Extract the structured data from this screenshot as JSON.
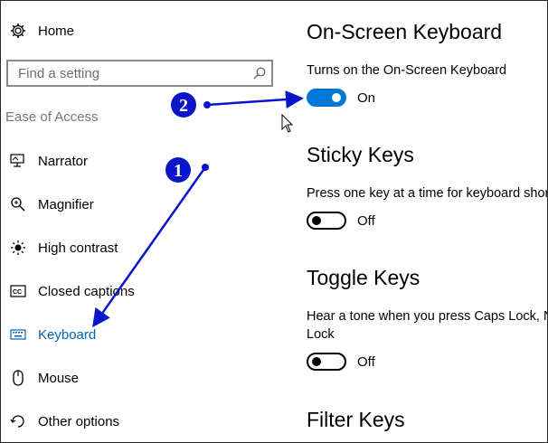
{
  "sidebar": {
    "home_label": "Home",
    "search_placeholder": "Find a setting",
    "group_label": "Ease of Access",
    "items": [
      {
        "label": "Narrator",
        "icon": "narrator-icon"
      },
      {
        "label": "Magnifier",
        "icon": "magnifier-icon"
      },
      {
        "label": "High contrast",
        "icon": "high-contrast-icon"
      },
      {
        "label": "Closed captions",
        "icon": "closed-captions-icon"
      },
      {
        "label": "Keyboard",
        "icon": "keyboard-icon",
        "active": true
      },
      {
        "label": "Mouse",
        "icon": "mouse-icon"
      },
      {
        "label": "Other options",
        "icon": "other-options-icon"
      }
    ]
  },
  "content": {
    "onscreen": {
      "title": "On-Screen Keyboard",
      "desc": "Turns on the On-Screen Keyboard",
      "state": "On"
    },
    "sticky": {
      "title": "Sticky Keys",
      "desc": "Press one key at a time for keyboard shortcuts",
      "state": "Off"
    },
    "toggle_keys": {
      "title": "Toggle Keys",
      "desc_line1": "Hear a tone when you press Caps Lock, Num",
      "desc_line2": "Lock",
      "state": "Off"
    },
    "filter": {
      "title": "Filter Keys"
    }
  },
  "annotations": {
    "step1": "1",
    "step2": "2",
    "color": "#0a14c8"
  },
  "colors": {
    "accent": "#0078d7",
    "active_nav": "#0063b1"
  }
}
